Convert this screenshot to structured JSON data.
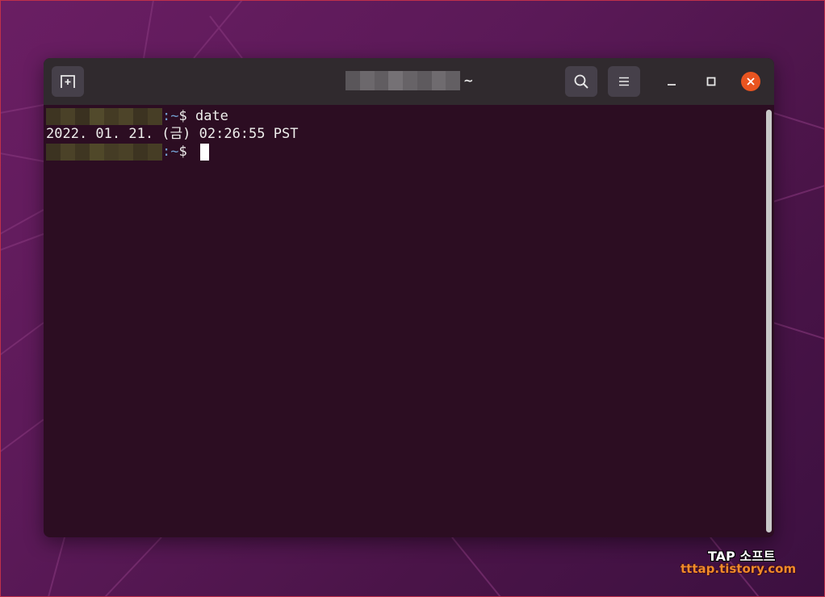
{
  "window": {
    "title_suffix": "~"
  },
  "terminal": {
    "lines": [
      {
        "path": ":~",
        "prompt": "$ ",
        "command": "date"
      },
      {
        "output": "2022. 01. 21. (금) 02:26:55 PST"
      },
      {
        "path": ":~",
        "prompt": "$ ",
        "command": ""
      }
    ]
  },
  "icons": {
    "new_tab": "new-tab-icon",
    "search": "search-icon",
    "menu": "hamburger-menu-icon",
    "minimize": "minimize-icon",
    "maximize": "maximize-icon",
    "close": "close-icon"
  },
  "colors": {
    "terminal_bg": "#2c0d22",
    "titlebar_bg": "#302a2e",
    "close_accent": "#e95420",
    "path_color": "#729fcf",
    "watermark_url_color": "#f08a2a"
  },
  "watermark": {
    "title": "TAP 소프트",
    "url": "tttap.tistory.com"
  }
}
